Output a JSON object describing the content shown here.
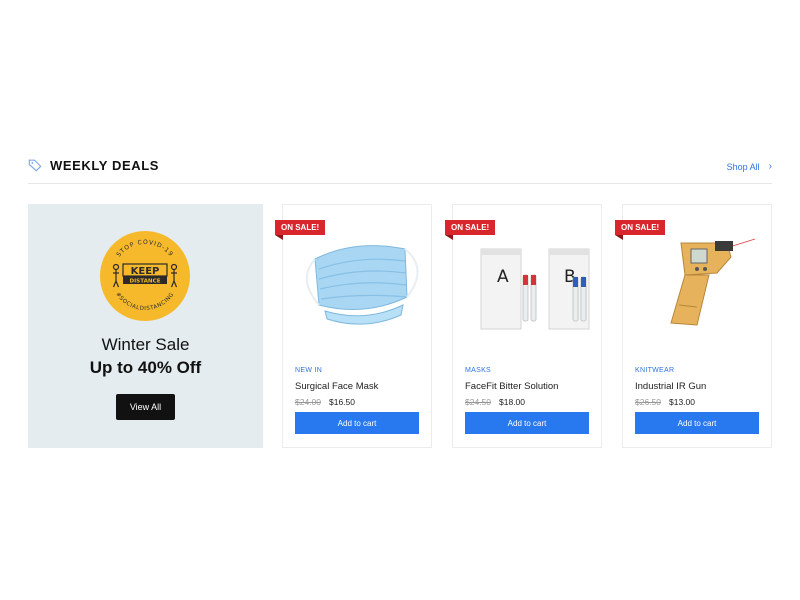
{
  "header": {
    "title": "WEEKLY DEALS",
    "shop_all": "Shop All",
    "icon": "tag-icon",
    "chevron": "›"
  },
  "promo": {
    "badge": {
      "top_text": "STOP COVID-19",
      "keep": "KEEP",
      "distance": "DISTANCE",
      "bottom_text": "#SOCIALDISTANCING",
      "color": "#f6b92b"
    },
    "title": "Winter Sale",
    "subtitle": "Up to 40% Off",
    "button": "View All"
  },
  "products": [
    {
      "sale_badge": "ON SALE!",
      "category": "NEW IN",
      "name": "Surgical Face Mask",
      "old_price": "$24.00",
      "price": "$16.50",
      "button": "Add to cart",
      "image": "surgical-mask"
    },
    {
      "sale_badge": "ON SALE!",
      "category": "MASKS",
      "name": "FaceFit Bitter Solution",
      "old_price": "$24.50",
      "price": "$18.00",
      "button": "Add to cart",
      "image": "fit-test-kit",
      "letters": [
        "A",
        "B"
      ]
    },
    {
      "sale_badge": "ON SALE!",
      "category": "KNITWEAR",
      "name": "Industrial IR Gun",
      "old_price": "$26.50",
      "price": "$13.00",
      "button": "Add to cart",
      "image": "ir-thermometer"
    }
  ],
  "colors": {
    "accent": "#2878f0",
    "sale": "#d9262c",
    "promo_bg": "#e4ecef"
  }
}
